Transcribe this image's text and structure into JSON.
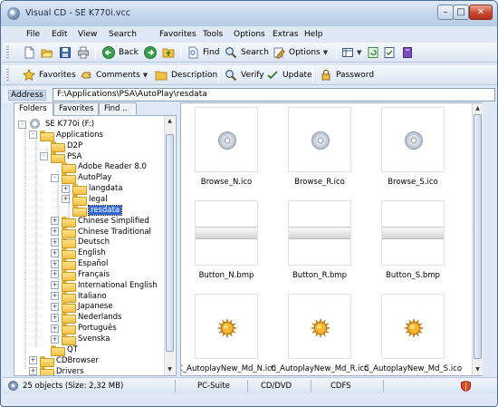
{
  "window": {
    "title": "Visual CD - SE K770i.vcc"
  },
  "menu": [
    "File",
    "Edit",
    "View",
    "Search",
    "Favorites",
    "Tools",
    "Options",
    "Extras",
    "Help"
  ],
  "toolbar1": {
    "back": "Back",
    "find": "Find",
    "search": "Search",
    "options": "Options"
  },
  "toolbar2": {
    "favorites": "Favorites",
    "comments": "Comments",
    "description": "Description",
    "verify": "Verify",
    "update": "Update",
    "password": "Password"
  },
  "address": {
    "label": "Address",
    "value": "F:\\Applications\\PSA\\AutoPlay\\resdata"
  },
  "left_tabs": [
    "Folders",
    "Favorites",
    "Find .."
  ],
  "tree": [
    {
      "label": "SE K770i (F:)"
    },
    {
      "label": "Applications"
    },
    {
      "label": "D2P"
    },
    {
      "label": "PSA"
    },
    {
      "label": "Adobe Reader 8.0"
    },
    {
      "label": "AutoPlay"
    },
    {
      "label": "langdata"
    },
    {
      "label": "legal"
    },
    {
      "label": "resdata"
    },
    {
      "label": "Chinese Simplified"
    },
    {
      "label": "Chinese Traditional"
    },
    {
      "label": "Deutsch"
    },
    {
      "label": "English"
    },
    {
      "label": "Español"
    },
    {
      "label": "Français"
    },
    {
      "label": "International English"
    },
    {
      "label": "Italiano"
    },
    {
      "label": "Japanese"
    },
    {
      "label": "Nederlands"
    },
    {
      "label": "Português"
    },
    {
      "label": "Svenska"
    },
    {
      "label": "QT"
    },
    {
      "label": "CDBrowser"
    },
    {
      "label": "Drivers"
    }
  ],
  "files": [
    {
      "name": "Browse_N.ico",
      "kind": "cd"
    },
    {
      "name": "Browse_R.ico",
      "kind": "cd"
    },
    {
      "name": "Browse_S.ico",
      "kind": "cd"
    },
    {
      "name": "Button_N.bmp",
      "kind": "bmp"
    },
    {
      "name": "Button_R.bmp",
      "kind": "bmp"
    },
    {
      "name": "Button_S.bmp",
      "kind": "bmp"
    },
    {
      "name": "C_AutoplayNew_Md_N.ico",
      "kind": "sun"
    },
    {
      "name": "C_AutoplayNew_Md_R.ico",
      "kind": "sun"
    },
    {
      "name": "C_AutoplayNew_Md_S.ico",
      "kind": "sun"
    }
  ],
  "status": {
    "objects": "25 objects (Size: 2,32 MB)",
    "category": "PC-Suite",
    "media": "CD/DVD",
    "filesystem": "CDFS"
  },
  "colors": {
    "accent": "#3168d5",
    "folder": "#f2c244",
    "frame": "#4a6f97"
  }
}
